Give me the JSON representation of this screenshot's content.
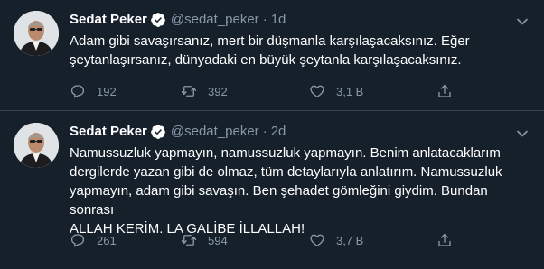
{
  "tweets": [
    {
      "author": {
        "display_name": "Sedat Peker",
        "handle": "@sedat_peker",
        "verified": true
      },
      "separator": "·",
      "time": "1d",
      "text_lines": [
        "Adam gibi savaşırsanız, mert bir düşmanla karşılaşacaksınız. Eğer",
        "şeytanlaşırsanız, dünyadaki en büyük şeytanla karşılaşacaksınız."
      ],
      "stats": {
        "replies": "192",
        "retweets": "392",
        "likes": "3,1 B"
      }
    },
    {
      "author": {
        "display_name": "Sedat Peker",
        "handle": "@sedat_peker",
        "verified": true
      },
      "separator": "·",
      "time": "2d",
      "text_lines": [
        "Namussuzluk yapmayın, namussuzluk yapmayın. Benim anlatacaklarım",
        "dergilerde yazan gibi de olmaz, tüm detaylarıyla anlatırım. Namussuzluk",
        "yapmayın, adam gibi savaşın. Ben şehadet gömleğini giydim. Bundan sonrası",
        "ALLAH KERİM. LA GALİBE İLLALLAH!"
      ],
      "stats": {
        "replies": "261",
        "retweets": "594",
        "likes": "3,7 B"
      }
    }
  ],
  "icons": {
    "verified": "verified-badge-icon",
    "more": "more-chevron-icon",
    "reply": "reply-bubble-icon",
    "retweet": "retweet-icon",
    "like": "heart-icon",
    "share": "share-upload-icon"
  },
  "colors": {
    "background": "#15202b",
    "divider": "#38444d",
    "text_primary": "#ffffff",
    "text_secondary": "#8899a6",
    "verified_blue": "#1da1f2"
  }
}
